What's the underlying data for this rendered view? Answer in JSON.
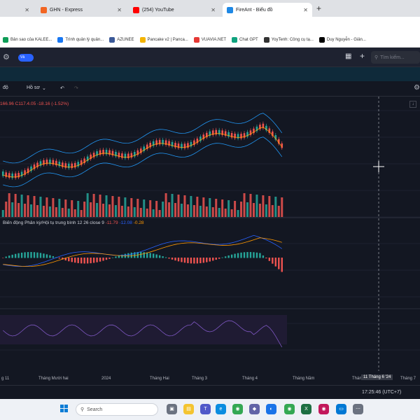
{
  "browser": {
    "tabs": [
      {
        "label": "GHN - Express",
        "color": "#f26522",
        "active": false
      },
      {
        "label": "(254) YouTube",
        "color": "#ff0000",
        "active": false
      },
      {
        "label": "FireAnt - Biểu đồ",
        "color": "#1e88e5",
        "active": true
      }
    ],
    "new_tab": "+",
    "bookmarks": [
      {
        "label": "Bản sao của KALEE...",
        "color": "#0f9d58"
      },
      {
        "label": "Trình quản lý quản...",
        "color": "#1877f2"
      },
      {
        "label": "AZUNEE",
        "color": "#3b5998"
      },
      {
        "label": "Pancake v2 | Panca...",
        "color": "#f4b400"
      },
      {
        "label": "VUAVIA.NET",
        "color": "#e53935"
      },
      {
        "label": "Chat GPT",
        "color": "#10a37f"
      },
      {
        "label": "YoyTenh: Công cụ tạ...",
        "color": "#333333"
      },
      {
        "label": "Duy Nguyễn - Giản...",
        "color": "#000000"
      }
    ]
  },
  "app": {
    "toggle_label": "Vả",
    "search_placeholder": "Tìm kiếm...",
    "toolbar": {
      "interval": "độ",
      "profile": "Hồ sơ"
    }
  },
  "chart": {
    "legend": "166.96 C117.4.05 -18.16 (-1.52%)",
    "macd_label": "Biến động Phân kỳ/Hội tụ trung bình 12 26 close 9",
    "macd_values": {
      "hist": "-11.79",
      "macd": "-12.08",
      "signal": "-0.28"
    },
    "time_labels": [
      "g 11",
      "Tháng Mười hai",
      "2024",
      "Tháng Hai",
      "Tháng 3",
      "Tháng 4",
      "Tháng Năm",
      "Thán",
      "Tháng 7"
    ],
    "cursor_label": "11 Tháng 6 '24",
    "clock": "17:25:46 (UTC+7)",
    "up_color": "#26a69a",
    "down_color": "#ef5350"
  },
  "taskbar": {
    "search_label": "Search",
    "apps": [
      "file-explorer",
      "teams",
      "edge",
      "chrome",
      "excel",
      "settings"
    ]
  }
}
